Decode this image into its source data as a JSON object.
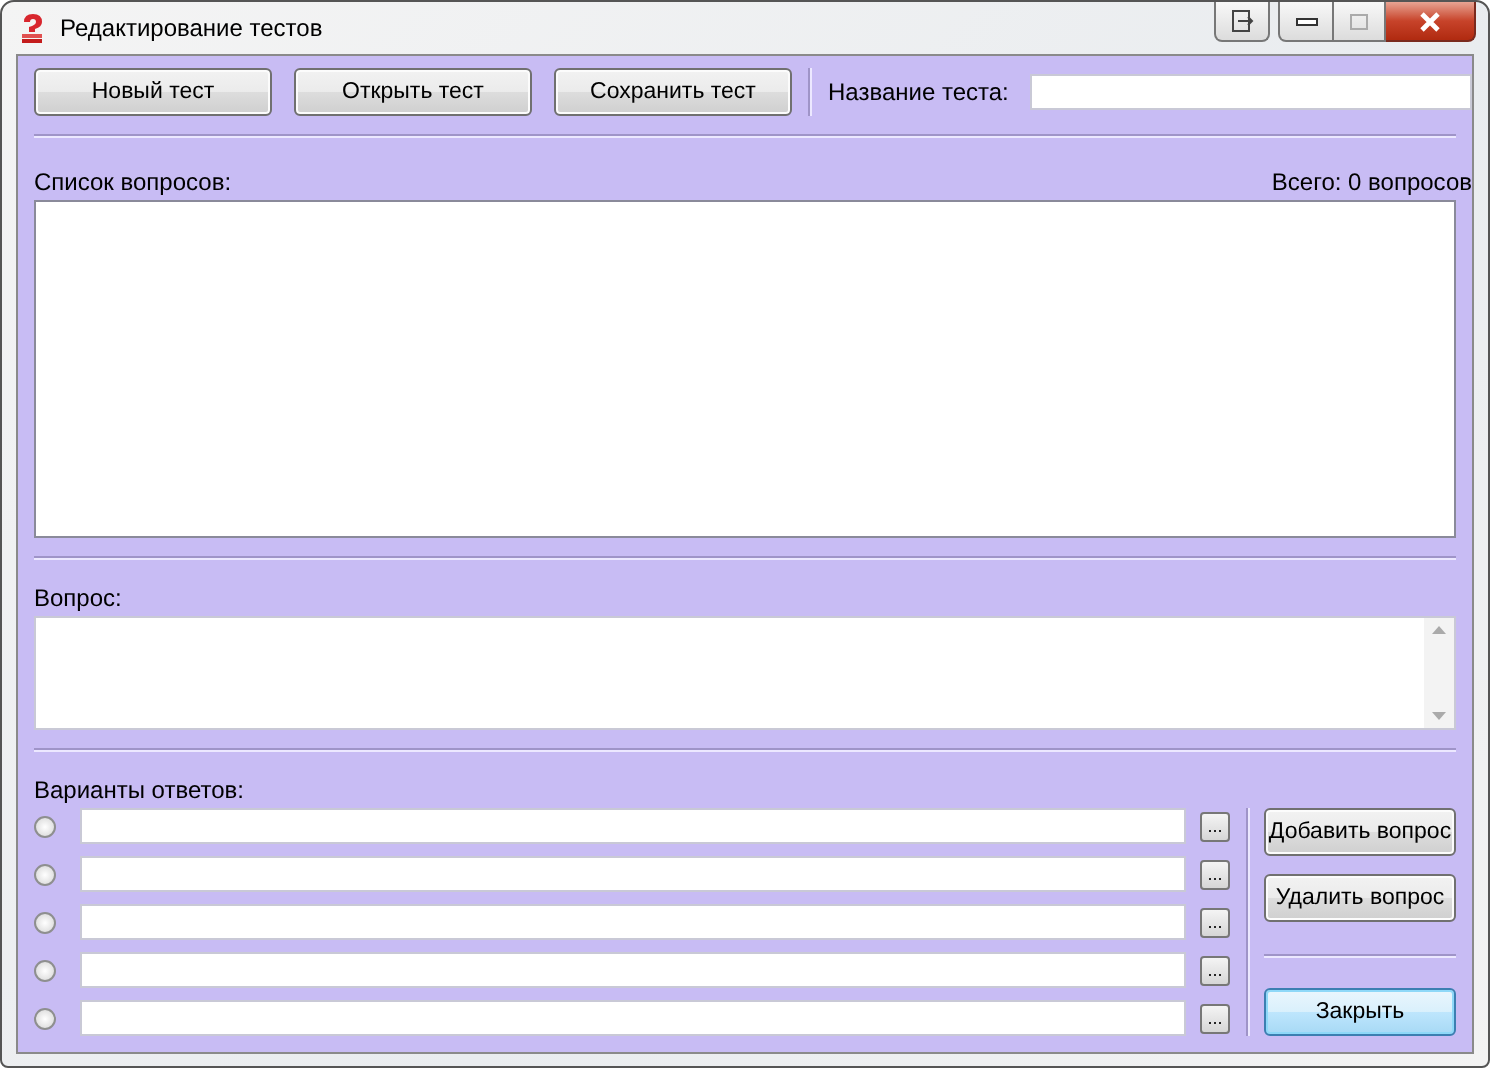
{
  "window": {
    "title": "Редактирование тестов"
  },
  "toolbar": {
    "buttons": [
      "Новый тест",
      "Открыть тест",
      "Сохранить тест"
    ],
    "test_name": {
      "label": "Название теста:"
    }
  },
  "questions": {
    "label": "Список вопросов:",
    "total": "Всего: 0 вопросов"
  },
  "question": {
    "label": "Вопрос:"
  },
  "answers": {
    "label": "Варианты ответов:",
    "items": [
      {
        "selected": false,
        "button": "..."
      },
      {
        "selected": false,
        "button": "..."
      },
      {
        "selected": false,
        "button": "..."
      },
      {
        "selected": false,
        "button": "..."
      },
      {
        "selected": false,
        "button": "..."
      }
    ]
  },
  "side_buttons": [
    {
      "label": "Добавить вопрос",
      "default": false
    },
    {
      "label": "Удалить вопрос",
      "default": false
    },
    {
      "label": "Закрыть",
      "default": true
    }
  ]
}
